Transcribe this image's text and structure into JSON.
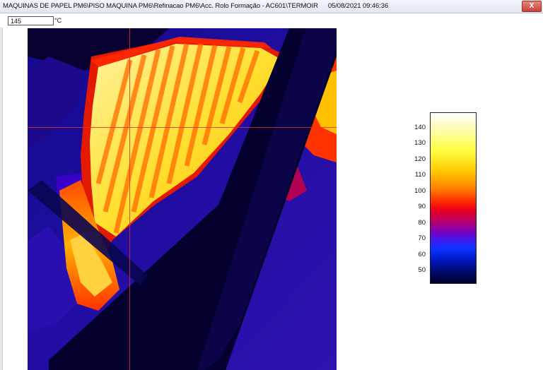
{
  "window": {
    "title": "MAQUINAS DE PAPEL PM6\\PISO MAQUINA PM6\\Refinacao PM6\\Acc. Rolo Formação - AC601\\TERMOIR",
    "timestamp": "05/08/2021 09:46:36",
    "close_label": "X"
  },
  "toolbar": {
    "temperature_value": "145",
    "temperature_unit": "°C"
  },
  "colorbar": {
    "ticks": [
      "140",
      "130",
      "120",
      "110",
      "100",
      "90",
      "80",
      "70",
      "60",
      "50"
    ],
    "colors": [
      "#ffffff",
      "#ffff40",
      "#ff7a00",
      "#e8001c",
      "#7a00c2",
      "#0a34ff",
      "#00002a"
    ]
  }
}
